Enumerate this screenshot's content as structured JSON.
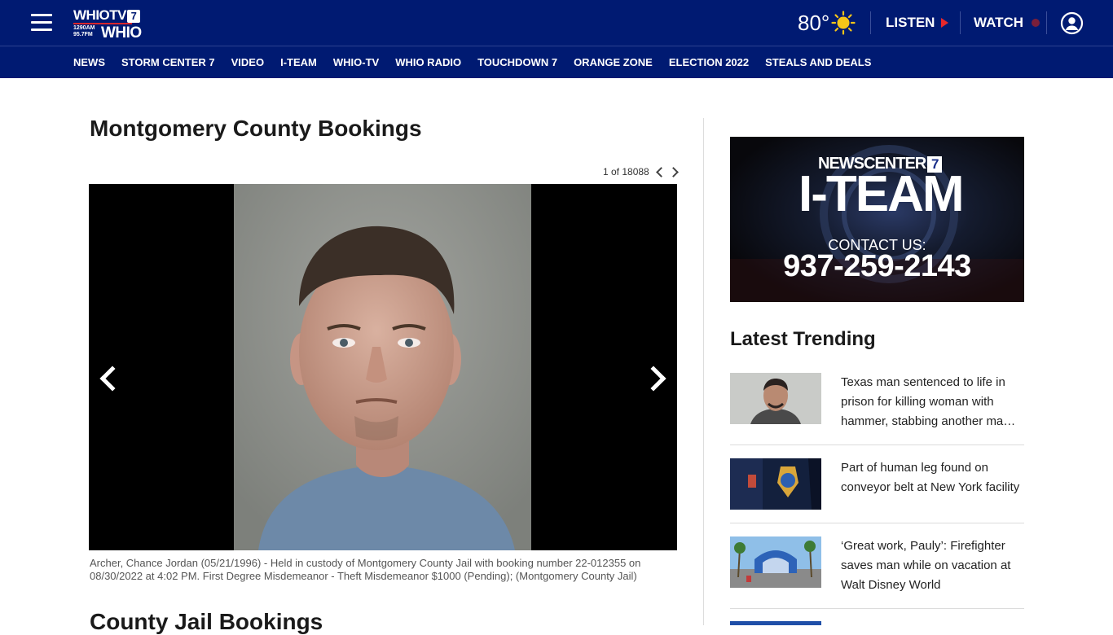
{
  "header": {
    "logo": {
      "top": "WHIOTV",
      "seven": "7",
      "freq_am": "1290AM",
      "freq_fm": "95.7FM",
      "bottom": "WHIO"
    },
    "weather": {
      "temperature": "80°",
      "icon": "sun-icon"
    },
    "listen_label": "LISTEN",
    "watch_label": "WATCH"
  },
  "nav": {
    "items": [
      "NEWS",
      "STORM CENTER 7",
      "VIDEO",
      "I-TEAM",
      "WHIO-TV",
      "WHIO RADIO",
      "TOUCHDOWN 7",
      "ORANGE ZONE",
      "ELECTION 2022",
      "STEALS AND DEALS"
    ]
  },
  "main": {
    "title": "Montgomery County Bookings",
    "gallery": {
      "position": "1 of 18088",
      "caption": "Archer, Chance Jordan (05/21/1996) - Held in custody of Montgomery County Jail with booking number 22-012355 on 08/30/2022 at 4:02 PM. First Degree Misdemeanor - Theft Misdemeanor $1000 (Pending); (Montgomery County Jail)"
    },
    "next_section_title": "County Jail Bookings"
  },
  "sidebar": {
    "ad": {
      "brand": "NEWSCENTER",
      "seven": "7",
      "headline": "I-TEAM",
      "contact": "CONTACT US:",
      "phone": "937-259-2143"
    },
    "trending": {
      "title": "Latest Trending",
      "items": [
        {
          "headline": "Texas man sentenced to life in prison for killing woman with hammer, stabbing another ma…"
        },
        {
          "headline": "Part of human leg found on conveyor belt at New York facility"
        },
        {
          "headline": "‘Great work, Pauly’: Firefighter saves man while on vacation at Walt Disney World"
        }
      ]
    }
  },
  "colors": {
    "brand_navy": "#001a72",
    "live_red": "#e8282b"
  }
}
